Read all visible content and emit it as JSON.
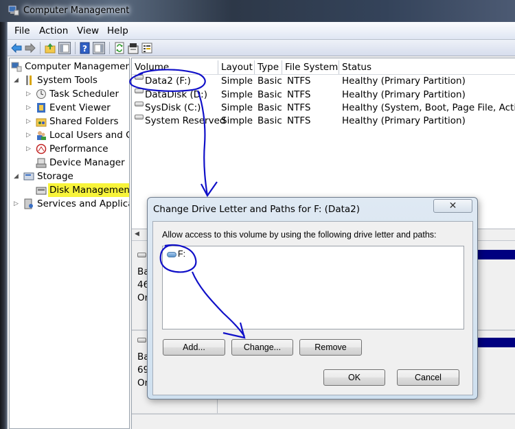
{
  "window": {
    "title": "Computer Management",
    "icon": "computer-management-icon"
  },
  "menu": [
    "File",
    "Action",
    "View",
    "Help"
  ],
  "toolbar": {
    "buttons": [
      "back-arrow-icon",
      "forward-arrow-icon",
      "up-folder-icon",
      "show-hide-console-tree-icon",
      "help-icon",
      "show-hide-action-pane-icon",
      "refresh-icon",
      "properties-icon",
      "export-list-icon"
    ]
  },
  "tree": {
    "root": "Computer Management",
    "items": [
      {
        "label": "System Tools",
        "expander": "expanded",
        "icon": "system-tools-icon"
      },
      {
        "label": "Task Scheduler",
        "expander": "collapsed",
        "icon": "clock-icon"
      },
      {
        "label": "Event Viewer",
        "expander": "collapsed",
        "icon": "event-viewer-icon"
      },
      {
        "label": "Shared Folders",
        "expander": "collapsed",
        "icon": "shared-folders-icon"
      },
      {
        "label": "Local Users and Groups",
        "expander": "collapsed",
        "icon": "users-icon"
      },
      {
        "label": "Performance",
        "expander": "collapsed",
        "icon": "performance-icon"
      },
      {
        "label": "Device Manager",
        "expander": "none",
        "icon": "device-manager-icon"
      },
      {
        "label": "Storage",
        "expander": "expanded",
        "icon": "storage-icon"
      },
      {
        "label": "Disk Management",
        "expander": "none",
        "icon": "disk-management-icon",
        "selected": true,
        "highlight_color": "#f8f43a"
      },
      {
        "label": "Services and Applications",
        "expander": "collapsed",
        "icon": "services-icon"
      }
    ]
  },
  "volumes": {
    "columns": [
      "Volume",
      "Layout",
      "Type",
      "File System",
      "Status"
    ],
    "rows": [
      {
        "volume": "Data2 (F:)",
        "layout": "Simple",
        "type": "Basic",
        "fs": "NTFS",
        "status": "Healthy (Primary Partition)"
      },
      {
        "volume": "DataDisk (D:)",
        "layout": "Simple",
        "type": "Basic",
        "fs": "NTFS",
        "status": "Healthy (Primary Partition)"
      },
      {
        "volume": "SysDisk (C:)",
        "layout": "Simple",
        "type": "Basic",
        "fs": "NTFS",
        "status": "Healthy (System, Boot, Page File, Active, C"
      },
      {
        "volume": "System Reserved",
        "layout": "Simple",
        "type": "Basic",
        "fs": "NTFS",
        "status": "Healthy (Primary Partition)"
      }
    ]
  },
  "disks": [
    {
      "line1": "Ba",
      "line2": "46",
      "line3": "On"
    },
    {
      "line1": "Ba",
      "line2": "69",
      "line3": "On"
    }
  ],
  "partition_color": "#000080",
  "dialog": {
    "title": "Change Drive Letter and Paths for F: (Data2)",
    "close_glyph": "✕",
    "prompt": "Allow access to this volume by using the following drive letter and paths:",
    "paths": [
      "F:"
    ],
    "buttons": {
      "add": "Add...",
      "change": "Change...",
      "remove": "Remove",
      "ok": "OK",
      "cancel": "Cancel"
    }
  },
  "annotations": {
    "color": "#1010c8",
    "marks": [
      "circle-around-data2-volume",
      "arrow-to-dialog",
      "circle-around-f-path",
      "arrow-to-change-button"
    ]
  }
}
